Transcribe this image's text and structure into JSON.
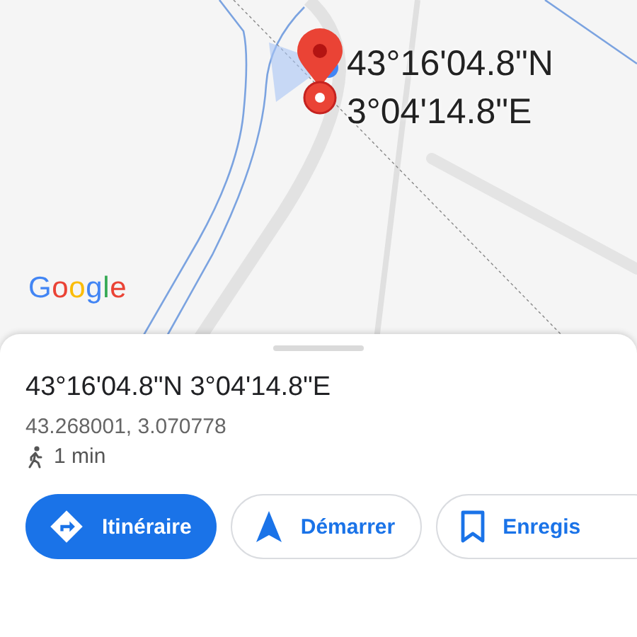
{
  "map": {
    "pin_label": [
      "43°16'04.8\"N",
      "3°04'14.8\"E"
    ],
    "logo": "Google"
  },
  "place": {
    "title": "43°16'04.8\"N 3°04'14.8\"E",
    "decimal": "43.268001, 3.070778",
    "walk_time": "1 min"
  },
  "actions": [
    {
      "kind": "directions",
      "label": "Itinéraire",
      "primary": true
    },
    {
      "kind": "start",
      "label": "Démarrer",
      "primary": false
    },
    {
      "kind": "save",
      "label": "Enregis",
      "primary": false
    }
  ]
}
